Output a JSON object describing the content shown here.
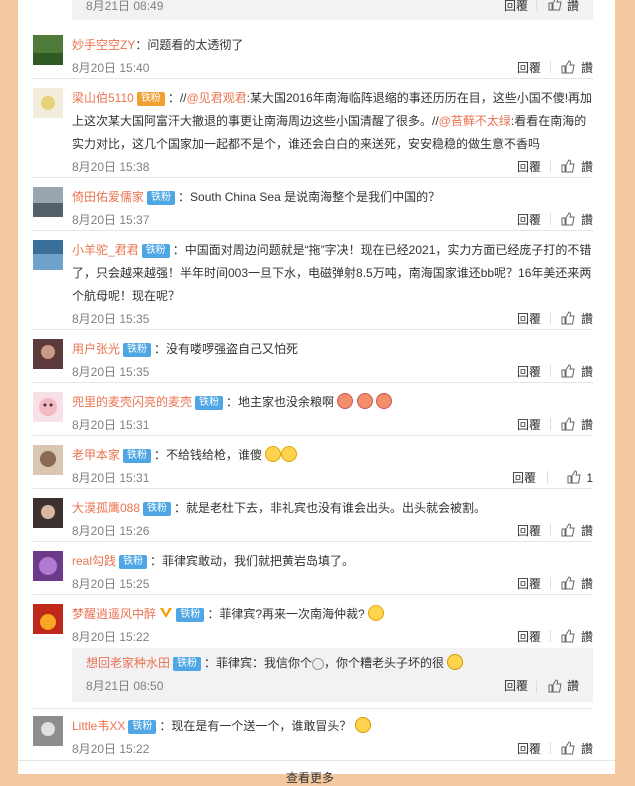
{
  "common": {
    "reply_label": "回覆",
    "like_label": "讚"
  },
  "top_sub": {
    "time": "8月21日 08:49"
  },
  "comments": [
    {
      "name": "妙手空空ZY",
      "text": "：问题看的太透彻了",
      "time": "8月20日 15:40",
      "likes": ""
    },
    {
      "name": "梁山伯5110",
      "badge": "铁粉",
      "text_pre": "：//",
      "mention1": "@见君观君",
      "text_mid": ":某大国2016年南海临阵退缩的事还历历在目，这些小国不傻!再加上这次某大国阿富汗大撤退的事更让南海周边这些小国清醒了很多。//",
      "mention2": "@苔藓不太绿",
      "text_post": ":看看在南海的实力对比，这几个国家加一起都不是个，谁还会白白的来送死，安安稳稳的做生意不香吗",
      "time": "8月20日 15:38",
      "likes": ""
    },
    {
      "name": "倚田佑爱儒家",
      "badge": "铁粉",
      "text": "：South China Sea 是说南海整个是我们中国的？",
      "time": "8月20日 15:37",
      "likes": ""
    },
    {
      "name": "小羊驼_君君",
      "badge": "铁粉",
      "text": "：中国面对周边问题就是“拖”字决！现在已经2021，实力方面已经庞子打的不错了，只会越来越强！半年时间003一旦下水，电磁弹射8.5万吨，南海国家谁还bb呢？16年美还来两个航母呢！现在呢？",
      "time": "8月20日 15:35",
      "likes": ""
    },
    {
      "name": "用户张光",
      "badge": "铁粉",
      "text": "：没有喽啰强盗自己又怕死",
      "time": "8月20日 15:35",
      "likes": ""
    },
    {
      "name": "兜里的麦壳闪亮的麦壳",
      "badge": "铁粉",
      "text": "：地主家也没余粮啊",
      "time": "8月20日 15:31",
      "likes": ""
    },
    {
      "name": "老甲本家",
      "badge": "铁粉",
      "text": "：不给钱给枪，谁傻",
      "time": "8月20日 15:31",
      "likes": "1"
    },
    {
      "name": "大漠孤鹰088",
      "badge": "铁粉",
      "text": "：就是老杜下去，非礼宾也没有谁会出头。出头就会被割。",
      "time": "8月20日 15:26",
      "likes": ""
    },
    {
      "name": "real勾践",
      "badge": "铁粉",
      "text": "：菲律宾敢动，我们就把黄岩岛填了。",
      "time": "8月20日 15:25",
      "likes": ""
    },
    {
      "name": "梦醒逍遥风中醉",
      "badge": "铁粉",
      "text": "：菲律宾?再来一次南海仲裁?",
      "time": "8月20日 15:22",
      "likes": ""
    },
    {
      "name": "Little韦XX",
      "badge": "铁粉",
      "text": "：现在是有一个送一个，谁敢冒头？",
      "time": "8月20日 15:22",
      "likes": ""
    }
  ],
  "subreply": {
    "name": "想回老家种水田",
    "badge": "铁粉",
    "text": "：菲律宾：我信你个",
    "text2": "，你个糟老头子坏的很",
    "time": "8月21日 08:50"
  },
  "more_label": "查看更多"
}
